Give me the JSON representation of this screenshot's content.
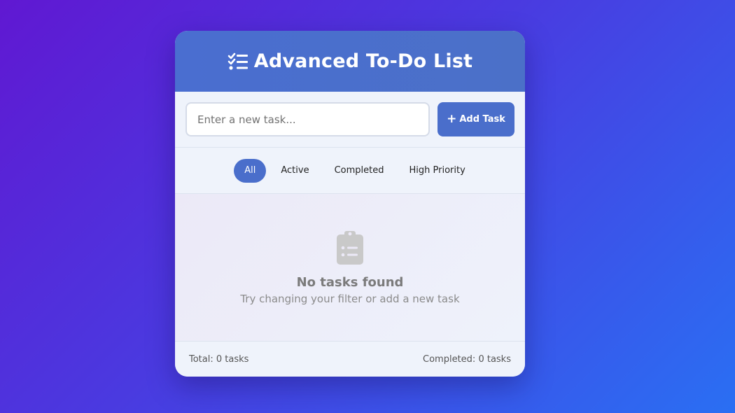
{
  "header": {
    "title": "Advanced To-Do List",
    "icon": "list-check-icon"
  },
  "input": {
    "placeholder": "Enter a new task...",
    "value": "",
    "add_button": {
      "icon": "plus-icon",
      "icon_glyph": "+",
      "label": "Add Task"
    }
  },
  "filters": {
    "items": [
      {
        "label": "All",
        "active": true
      },
      {
        "label": "Active",
        "active": false
      },
      {
        "label": "Completed",
        "active": false
      },
      {
        "label": "High Priority",
        "active": false
      }
    ]
  },
  "empty_state": {
    "icon": "clipboard-list-icon",
    "title": "No tasks found",
    "subtitle": "Try changing your filter or add a new task"
  },
  "footer": {
    "total": "Total: 0 tasks",
    "completed": "Completed: 0 tasks"
  },
  "colors": {
    "accent": "#4a6ecb",
    "background_start": "#6018d2",
    "background_end": "#2a6ff3",
    "card": "#eff3fb"
  }
}
